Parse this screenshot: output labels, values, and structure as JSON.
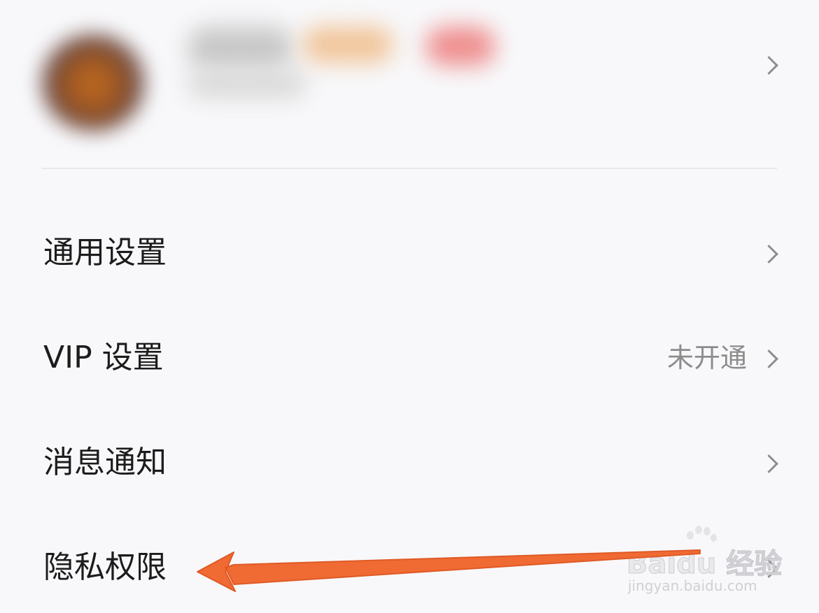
{
  "profile": {
    "name_blurred": true
  },
  "menu": [
    {
      "label": "通用设置",
      "value": ""
    },
    {
      "label": "VIP 设置",
      "value": "未开通"
    },
    {
      "label": "消息通知",
      "value": ""
    },
    {
      "label": "隐私权限",
      "value": ""
    }
  ],
  "watermark": {
    "brand": "Bai",
    "brand_suffix": "du 经验",
    "url": "jingyan.baidu.com"
  },
  "annotation": {
    "arrow_color": "#f06a33"
  },
  "icons": {
    "row_chevron": "chevron-right-icon"
  }
}
